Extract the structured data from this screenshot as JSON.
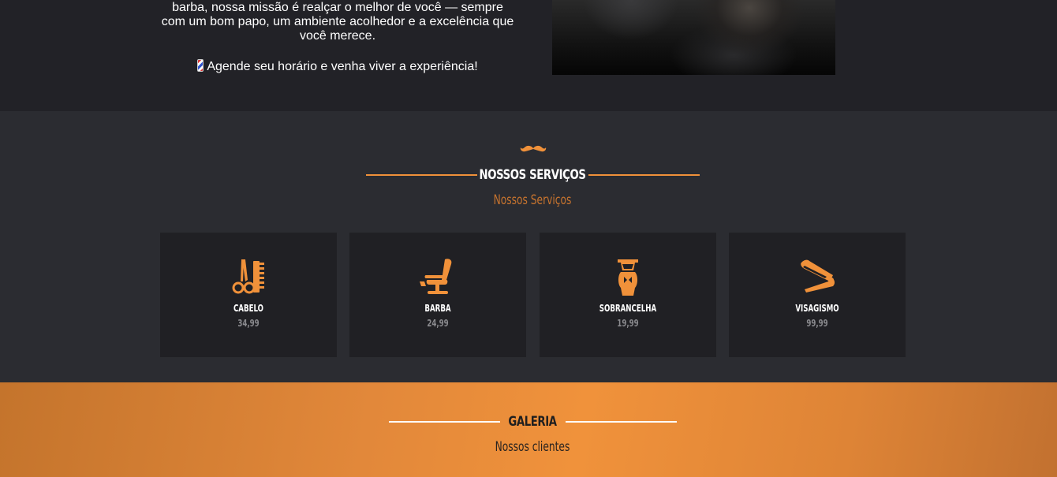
{
  "about": {
    "line1": "barba, nossa missão é realçar o melhor de você — sempre",
    "line2": "com um bom papo, um ambiente acolhedor e a excelência que",
    "line3": "você merece.",
    "cta": "Agende seu horário e venha viver a experiência!"
  },
  "services": {
    "title": "NOSSOS SERVIÇOS",
    "subtitle": "Nossos Serviços",
    "items": [
      {
        "name": "CABELO",
        "price": "34,99",
        "icon": "scissors-comb-icon"
      },
      {
        "name": "BARBA",
        "price": "24,99",
        "icon": "barber-chair-icon"
      },
      {
        "name": "SOBRANCELHA",
        "price": "19,99",
        "icon": "shaving-brush-icon"
      },
      {
        "name": "VISAGISMO",
        "price": "99,99",
        "icon": "straight-razor-icon"
      }
    ]
  },
  "gallery": {
    "title": "GALERIA",
    "subtitle": "Nossos clientes"
  },
  "colors": {
    "accent": "#f0913a",
    "dark_bg": "#222227",
    "section_bg": "#2b2c31",
    "card_bg": "#202024"
  }
}
